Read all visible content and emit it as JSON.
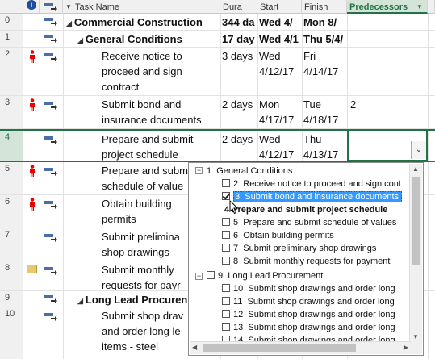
{
  "header": {
    "task_name": "Task Name",
    "duration": "Dura",
    "start": "Start",
    "finish": "Finish",
    "predecessors": "Predecessors",
    "info_icon": "info-icon",
    "mode_icon": "task-mode-icon"
  },
  "rows": [
    {
      "id": "0",
      "name": "Commercial Construction",
      "dur": "344 da",
      "start": "Wed 4/",
      "finish": "Mon 8/",
      "pred": "",
      "bold": true
    },
    {
      "id": "1",
      "name": "General Conditions",
      "dur": "17 day",
      "start": "Wed 4/1",
      "finish": "Thu 5/4/",
      "pred": "",
      "bold": true
    },
    {
      "id": "2",
      "name_lines": [
        "Receive notice to",
        "proceed and sign",
        "contract"
      ],
      "dur": "3 days",
      "start_lines": [
        "Wed",
        "4/12/17"
      ],
      "finish_lines": [
        "Fri",
        "4/14/17"
      ],
      "pred": ""
    },
    {
      "id": "3",
      "name_lines": [
        "Submit bond and",
        "insurance documents"
      ],
      "dur": "2 days",
      "start_lines": [
        "Mon",
        "4/17/17"
      ],
      "finish_lines": [
        "Tue",
        "4/18/17"
      ],
      "pred": "2"
    },
    {
      "id": "4",
      "name_lines": [
        "Prepare and submit",
        "project schedule"
      ],
      "dur": "2 days",
      "start_lines": [
        "Wed",
        "4/12/17"
      ],
      "finish_lines": [
        "Thu",
        "4/13/17"
      ],
      "pred": ""
    },
    {
      "id": "5",
      "name_lines": [
        "Prepare and subm",
        "schedule of value"
      ]
    },
    {
      "id": "6",
      "name_lines": [
        "Obtain building",
        "permits"
      ]
    },
    {
      "id": "7",
      "name_lines": [
        "Submit prelimina",
        "shop drawings"
      ]
    },
    {
      "id": "8",
      "name_lines": [
        "Submit monthly",
        "requests for payr"
      ]
    },
    {
      "id": "9",
      "name": "Long Lead Procuren",
      "bold": true
    },
    {
      "id": "10",
      "name_lines": [
        "Submit shop drav",
        "and order long le",
        "items - steel"
      ]
    }
  ],
  "dropdown": {
    "items": [
      {
        "num": "1",
        "label": "General Conditions",
        "checked": false,
        "expander": "−"
      },
      {
        "num": "2",
        "label": "Receive notice to proceed and sign cont",
        "checked": false
      },
      {
        "num": "3",
        "label": "Submit bond and insurance documents",
        "checked": true,
        "selected": true
      },
      {
        "num": "4",
        "label": "Prepare and submit project schedule",
        "current": true
      },
      {
        "num": "5",
        "label": "Prepare and submit schedule of values",
        "checked": false
      },
      {
        "num": "6",
        "label": "Obtain building permits",
        "checked": false
      },
      {
        "num": "7",
        "label": "Submit preliminary shop drawings",
        "checked": false
      },
      {
        "num": "8",
        "label": "Submit monthly requests for payment",
        "checked": false
      },
      {
        "num": "9",
        "label": "Long Lead Procurement",
        "checked": false,
        "expander": "−"
      },
      {
        "num": "10",
        "label": "Submit shop drawings and order long",
        "checked": false
      },
      {
        "num": "11",
        "label": "Submit shop drawings and order long",
        "checked": false
      },
      {
        "num": "12",
        "label": "Submit shop drawings and order long",
        "checked": false
      },
      {
        "num": "13",
        "label": "Submit shop drawings and order long",
        "checked": false
      },
      {
        "num": "14",
        "label": "Submit shop drawings and order long",
        "checked": false
      }
    ]
  },
  "colors": {
    "accent": "#217346",
    "selection": "#3399ff",
    "current_row_border": "#217346",
    "header_pred_bg": "#d4e4d8"
  }
}
